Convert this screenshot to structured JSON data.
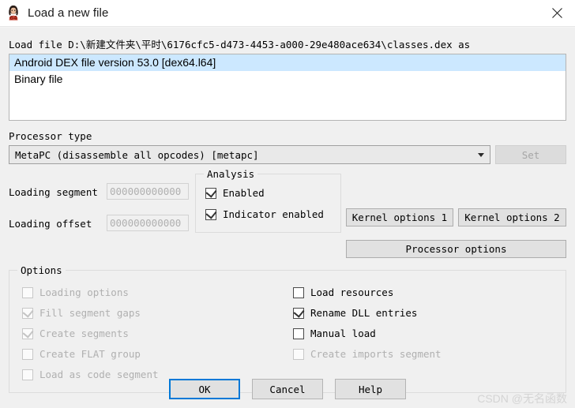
{
  "window": {
    "title": "Load a new file",
    "icon": "ida-logo-icon",
    "close_label": "close-icon"
  },
  "file": {
    "prompt": "Load file D:\\新建文件夹\\平时\\6176cfc5-d473-4453-a000-29e480ace634\\classes.dex as",
    "types": [
      {
        "label": "Android DEX file version 53.0 [dex64.l64]",
        "selected": true
      },
      {
        "label": "Binary file",
        "selected": false
      }
    ]
  },
  "processor": {
    "label": "Processor type",
    "value": "MetaPC (disassemble all opcodes) [metapc]",
    "set_label": "Set",
    "set_enabled": false
  },
  "loading": {
    "segment_label": "Loading segment",
    "segment_value": "000000000000",
    "offset_label": "Loading offset",
    "offset_value": "000000000000"
  },
  "analysis": {
    "title": "Analysis",
    "items": [
      {
        "label": "Enabled",
        "checked": true,
        "enabled": true
      },
      {
        "label": "Indicator enabled",
        "checked": true,
        "enabled": true
      }
    ]
  },
  "side_buttons": [
    {
      "label": "Kernel options 1"
    },
    {
      "label": "Kernel options 2"
    },
    {
      "label": "Processor options"
    }
  ],
  "options": {
    "title": "Options",
    "left": [
      {
        "label": "Loading options",
        "checked": false,
        "enabled": false
      },
      {
        "label": "Fill segment gaps",
        "checked": true,
        "enabled": false
      },
      {
        "label": "Create segments",
        "checked": true,
        "enabled": false
      },
      {
        "label": "Create FLAT group",
        "checked": false,
        "enabled": false
      },
      {
        "label": "Load as code segment",
        "checked": false,
        "enabled": false
      }
    ],
    "right": [
      {
        "label": "Load resources",
        "checked": false,
        "enabled": true
      },
      {
        "label": "Rename DLL entries",
        "checked": true,
        "enabled": true
      },
      {
        "label": "Manual load",
        "checked": false,
        "enabled": true
      },
      {
        "label": "Create imports segment",
        "checked": false,
        "enabled": false
      }
    ]
  },
  "dialog_buttons": [
    {
      "label": "OK",
      "focused": true
    },
    {
      "label": "Cancel",
      "focused": false
    },
    {
      "label": "Help",
      "focused": false
    }
  ],
  "watermark": "CSDN @无名函数",
  "colors": {
    "accent": "#0078d7",
    "selection": "#cce8ff",
    "window_bg": "#f0f0f0",
    "titlebar_bg": "#ffffff"
  }
}
